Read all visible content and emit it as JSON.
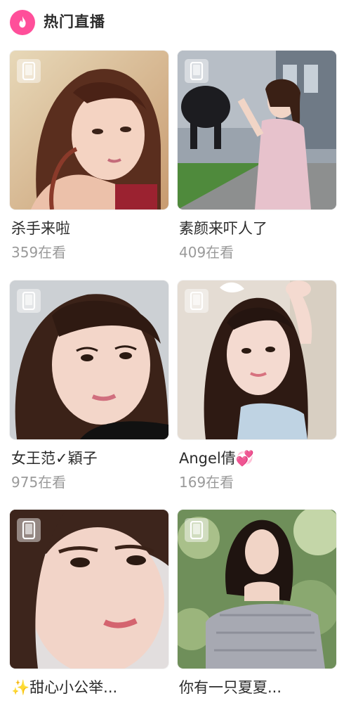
{
  "header": {
    "title": "热门直播",
    "icon": "flame-icon",
    "accent": "#ff4f9a"
  },
  "streams": [
    {
      "title": "杀手来啦",
      "viewers": "359在看",
      "badge_icon": "phone-icon"
    },
    {
      "title": "素颜来吓人了",
      "viewers": "409在看",
      "badge_icon": "phone-icon"
    },
    {
      "title": "女王范✓穎子",
      "viewers": "975在看",
      "badge_icon": "phone-icon"
    },
    {
      "title": "Angel倩💞",
      "viewers": "169在看",
      "badge_icon": "phone-icon"
    },
    {
      "title": "✨甜心小公举...",
      "viewers": "",
      "badge_icon": "phone-icon"
    },
    {
      "title": "你有一只夏夏...",
      "viewers": "",
      "badge_icon": "phone-icon"
    }
  ]
}
